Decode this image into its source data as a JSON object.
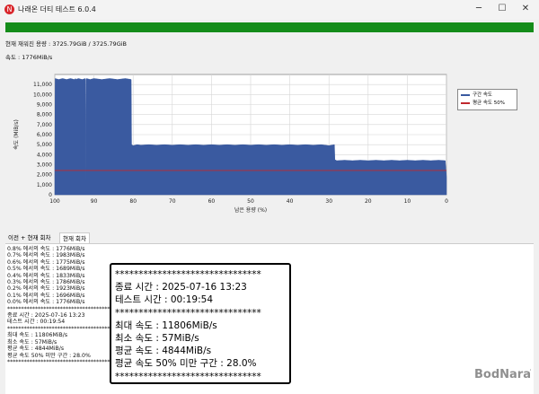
{
  "window": {
    "title": "나래온 더티 테스트 6.0.4",
    "app_icon_glyph": "N",
    "minimize_glyph": "─",
    "maximize_glyph": "☐",
    "close_glyph": "✕"
  },
  "progress": {
    "fraction": 1.0,
    "color": "#148c1a"
  },
  "status": {
    "written_label": "현재 재워진 용량 : 3725.79GiB / 3725.79GiB",
    "speed_label": "속도 : 1776MiB/s"
  },
  "chart_data": {
    "type": "area",
    "xlabel": "남은 용량 (%)",
    "ylabel": "속도 (MiB/s)",
    "xlim": [
      100,
      0
    ],
    "ylim": [
      0,
      12000
    ],
    "x_ticks": [
      100,
      90,
      80,
      70,
      60,
      50,
      40,
      30,
      20,
      10,
      0
    ],
    "y_ticks": [
      0,
      1000,
      2000,
      3000,
      4000,
      5000,
      6000,
      7000,
      8000,
      9000,
      10000,
      11000
    ],
    "y_tick_labels": [
      "0",
      "1,000",
      "2,000",
      "3,000",
      "4,000",
      "5,000",
      "6,000",
      "7,000",
      "8,000",
      "9,000",
      "10,000",
      "11,000"
    ],
    "grid": true,
    "legend_position": "right",
    "series": [
      {
        "name": "구간 속도",
        "color": "#3a5aa0",
        "x": [
          100,
          99.9,
          99,
          98,
          97,
          96,
          95,
          94.7,
          94.6,
          94,
          93,
          92.2,
          92.1,
          92,
          91.9,
          91,
          90,
          88,
          86,
          84,
          82,
          80.5,
          80.4,
          80,
          79,
          78,
          76,
          74,
          72,
          70,
          68,
          66,
          64,
          62,
          60,
          58,
          56,
          54,
          52,
          50,
          48,
          46,
          44,
          42,
          40,
          38,
          36,
          34,
          32,
          30,
          28.6,
          28.5,
          28,
          26,
          24,
          22,
          20,
          18,
          16,
          14,
          12,
          10,
          8,
          6,
          4,
          2,
          0.3,
          0
        ],
        "y": [
          2900,
          11600,
          11500,
          11600,
          11500,
          11600,
          11500,
          11600,
          11500,
          11600,
          11500,
          11600,
          900,
          11500,
          11600,
          11500,
          11600,
          11500,
          11600,
          11500,
          11600,
          11500,
          5000,
          4900,
          5000,
          4950,
          5000,
          4950,
          5000,
          4950,
          5000,
          4950,
          5000,
          4950,
          5000,
          4950,
          5000,
          4950,
          5000,
          4950,
          5000,
          4950,
          5000,
          4950,
          5000,
          4950,
          5000,
          4950,
          5000,
          4900,
          5000,
          3500,
          3400,
          3450,
          3400,
          3450,
          3400,
          3450,
          3400,
          3450,
          3400,
          3450,
          3400,
          3450,
          3400,
          3450,
          3400,
          1776
        ]
      },
      {
        "name": "평균 속도 50%",
        "color": "#c0282d",
        "x": [
          100,
          0
        ],
        "y": [
          2422,
          2422
        ]
      }
    ]
  },
  "tabs": [
    {
      "label": "이전 + 현재 회차"
    },
    {
      "label": "현재 회차"
    }
  ],
  "log": {
    "lines": [
      "0.8% 에서의 속도 : 1776MiB/s",
      "0.7% 에서의 속도 : 1983MiB/s",
      "0.6% 에서의 속도 : 1775MiB/s",
      "0.5% 에서의 속도 : 1689MiB/s",
      "0.4% 에서의 속도 : 1833MiB/s",
      "0.3% 에서의 속도 : 1786MiB/s",
      "0.2% 에서의 속도 : 1923MiB/s",
      "0.1% 에서의 속도 : 1696MiB/s",
      "0.0% 에서의 속도 : 1776MiB/s",
      "****************************************",
      "종료 시간 : 2025-07-16 13:23",
      "테스트 시간 : 00:19:54",
      "****************************************",
      "최대 속도 : 11806MiB/s",
      "최소 속도 : 57MiB/s",
      "평균 속도 : 4844MiB/s",
      "평균 속도 50% 미만 구간 : 28.0%",
      "****************************************"
    ]
  },
  "summary": {
    "stars": "*******************************",
    "end_time": "종료 시간 : 2025-07-16 13:23",
    "test_time": "테스트 시간 : 00:19:54",
    "max_speed": "최대 속도 : 11806MiB/s",
    "min_speed": "최소 속도 : 57MiB/s",
    "avg_speed": "평균 속도 : 4844MiB/s",
    "below_half": "평균 속도 50% 미만 구간 : 28.0%"
  },
  "watermark": "BodNara"
}
